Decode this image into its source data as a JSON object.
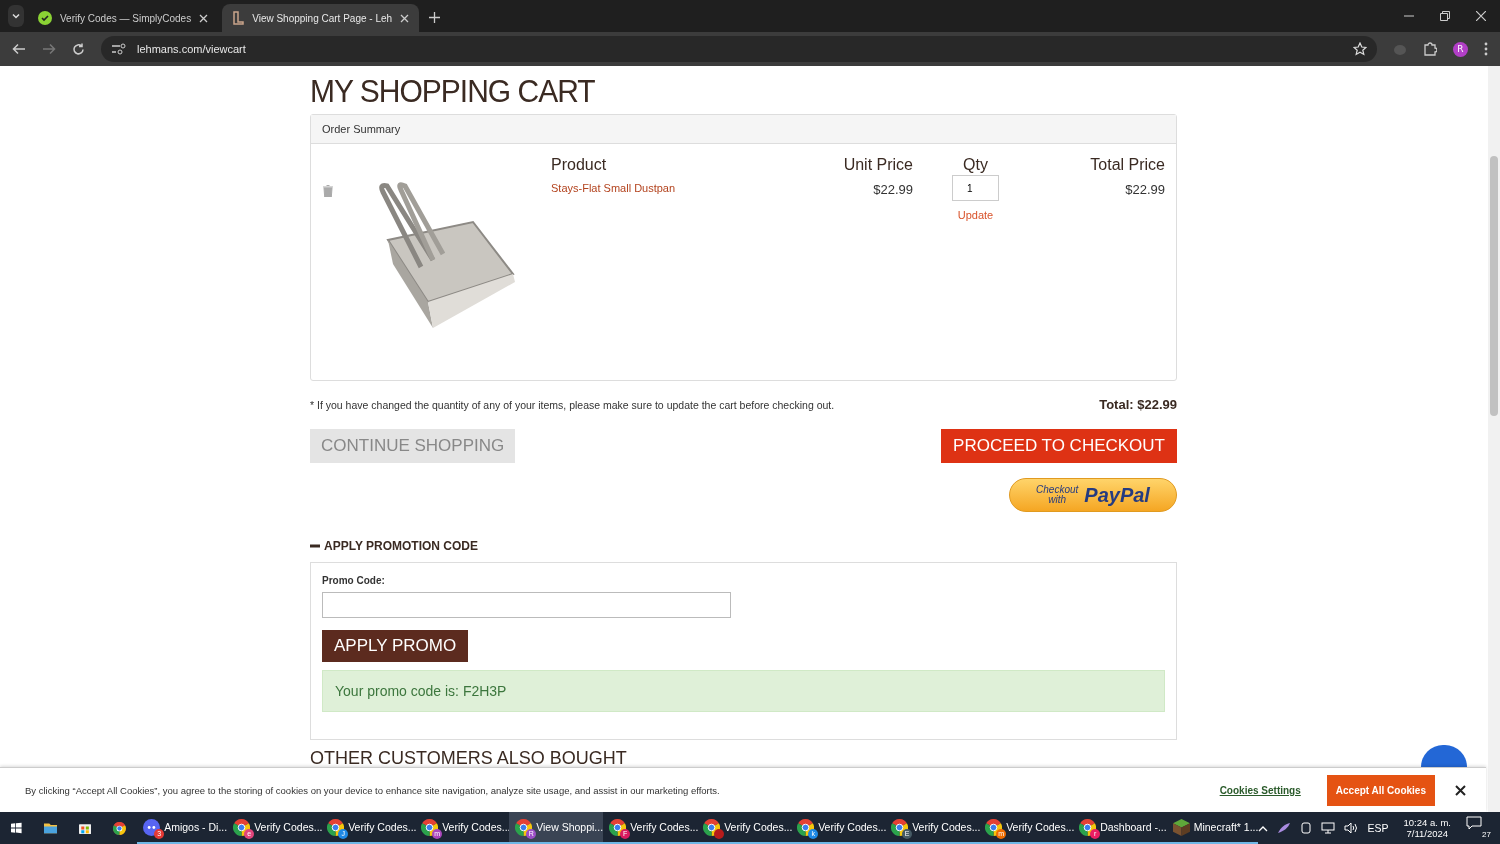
{
  "browser": {
    "tabs": [
      {
        "title": "Verify Codes — SimplyCodes",
        "selected": false,
        "kind": "check"
      },
      {
        "title": "View Shopping Cart Page - Leh",
        "selected": true,
        "kind": "logo"
      }
    ],
    "url": "lehmans.com/viewcart",
    "avatar": "R"
  },
  "page": {
    "title": "MY SHOPPING CART",
    "order_summary": "Order Summary",
    "columns": [
      "Product",
      "Unit Price",
      "Qty",
      "Total Price"
    ],
    "items": [
      {
        "name": "Stays-Flat Small Dustpan",
        "unit_price": "$22.99",
        "qty": "1",
        "update": "Update",
        "total": "$22.99"
      }
    ],
    "note": "* If you have changed the quantity of any of your items, please make sure to update the cart before checking out.",
    "total": "Total: $22.99",
    "continue": "CONTINUE SHOPPING",
    "checkout": "PROCEED TO CHECKOUT",
    "paypal": {
      "top": "Checkout",
      "bottom": "with",
      "brand": "PayPal"
    },
    "promo": {
      "heading": "APPLY PROMOTION CODE",
      "expanded": true,
      "label": "Promo Code:",
      "button": "APPLY PROMO",
      "message": "Your promo code is: F2H3P"
    },
    "section_heading": "OTHER CUSTOMERS ALSO BOUGHT"
  },
  "cookie_banner": {
    "text": "By clicking “Accept All Cookies”, you agree to the storing of cookies on your device to enhance site navigation, analyze site usage, and assist in our marketing efforts.",
    "settings": "Cookies Settings",
    "accept": "Accept All Cookies"
  },
  "taskbar": {
    "apps": [
      {
        "label": "Amigos - Di...",
        "badge": "3",
        "kind": "discord",
        "selected": false
      },
      {
        "label": "Verify Codes...",
        "badge": "e",
        "color": "#e0457b",
        "kind": "chrome",
        "selected": false
      },
      {
        "label": "Verify Codes...",
        "badge": "J",
        "color": "#1e88e5",
        "kind": "chrome",
        "selected": false
      },
      {
        "label": "Verify Codes...",
        "badge": "m",
        "color": "#ab47bc",
        "kind": "chrome",
        "selected": false
      },
      {
        "label": "View Shoppi...",
        "badge": "R",
        "color": "#9c4fc7",
        "kind": "chrome",
        "selected": true
      },
      {
        "label": "Verify Codes...",
        "badge": "F",
        "color": "#d81b60",
        "kind": "chrome",
        "selected": false
      },
      {
        "label": "Verify Codes...",
        "color": "#b71c1c",
        "kind": "chrome",
        "selected": false
      },
      {
        "label": "Verify Codes...",
        "badge": "k",
        "color": "#1e88e5",
        "kind": "chrome",
        "selected": false
      },
      {
        "label": "Verify Codes...",
        "badge": "E",
        "color": "#455a64",
        "kind": "chrome",
        "selected": false
      },
      {
        "label": "Verify Codes...",
        "badge": "m",
        "color": "#ef6c00",
        "kind": "chrome",
        "selected": false
      },
      {
        "label": "Dashboard -...",
        "badge": "r",
        "color": "#e91e63",
        "kind": "chrome",
        "selected": false
      },
      {
        "label": "Minecraft* 1...",
        "kind": "minecraft",
        "selected": false
      }
    ],
    "language": "ESP",
    "time": "10:24 a. m.",
    "date": "7/11/2024",
    "notifications": "27"
  }
}
